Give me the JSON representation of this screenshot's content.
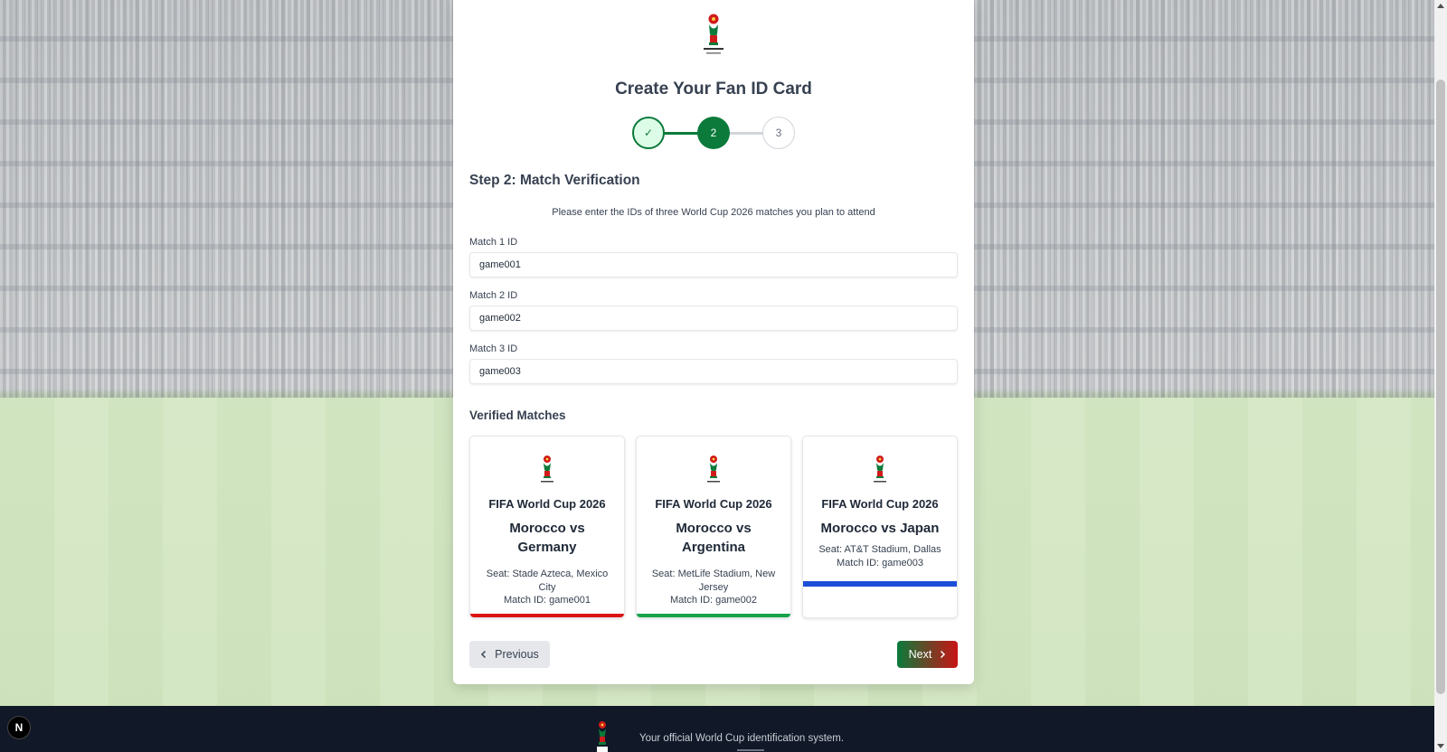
{
  "card": {
    "title": "Create Your Fan ID Card",
    "steps": [
      "✓",
      "2",
      "3"
    ]
  },
  "step2": {
    "heading": "Step 2: Match Verification",
    "instruction": "Please enter the IDs of three World Cup 2026 matches you plan to attend",
    "fields": [
      {
        "label": "Match 1 ID",
        "value": "game001"
      },
      {
        "label": "Match 2 ID",
        "value": "game002"
      },
      {
        "label": "Match 3 ID",
        "value": "game003"
      }
    ]
  },
  "verified": {
    "heading": "Verified Matches",
    "matches": [
      {
        "tournament": "FIFA World Cup 2026",
        "teams": "Morocco vs Germany",
        "seat": "Seat: Stade Azteca, Mexico City",
        "match_id": "Match ID: game001",
        "accent": "#dc1414"
      },
      {
        "tournament": "FIFA World Cup 2026",
        "teams": "Morocco vs Argentina",
        "seat": "Seat: MetLife Stadium, New Jersey",
        "match_id": "Match ID: game002",
        "accent": "#16a34a"
      },
      {
        "tournament": "FIFA World Cup 2026",
        "teams": "Morocco vs Japan",
        "seat": "Seat: AT&T Stadium, Dallas",
        "match_id": "Match ID: game003",
        "accent": "#1d4ed8"
      }
    ]
  },
  "nav": {
    "previous_label": "Previous",
    "next_label": "Next"
  },
  "footer": {
    "tagline": "Your official World Cup identification system."
  },
  "devtools_badge": "N"
}
